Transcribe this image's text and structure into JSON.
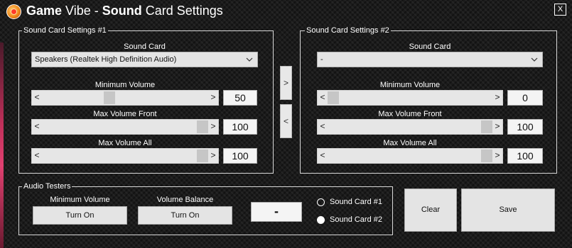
{
  "window": {
    "title_part1": "Game",
    "title_part2": " Vibe - ",
    "title_part3": "Sound",
    "title_part4": " Card Settings",
    "close_label": "X"
  },
  "group1": {
    "title": "Sound Card Settings #1",
    "sound_card_label": "Sound Card",
    "sound_card_value": "Speakers (Realtek High Definition Audio)",
    "min_volume_label": "Minimum Volume",
    "min_volume_value": "50",
    "min_volume_level": 0.4,
    "max_front_label": "Max Volume Front",
    "max_front_value": "100",
    "max_front_level": 1.0,
    "max_all_label": "Max Volume All",
    "max_all_value": "100",
    "max_all_level": 1.0
  },
  "group2": {
    "title": "Sound Card Settings #2",
    "sound_card_label": "Sound Card",
    "sound_card_value": "-",
    "min_volume_label": "Minimum Volume",
    "min_volume_value": "0",
    "min_volume_level": 0.0,
    "max_front_label": "Max Volume Front",
    "max_front_value": "100",
    "max_front_level": 1.0,
    "max_all_label": "Max Volume All",
    "max_all_value": "100",
    "max_all_level": 1.0
  },
  "transfer": {
    "right_label": ">",
    "left_label": "<"
  },
  "audio_testers": {
    "title": "Audio Testers",
    "min_volume_label": "Minimum Volume",
    "min_volume_button": "Turn On",
    "balance_label": "Volume Balance",
    "balance_button": "Turn On",
    "dash_button": "-",
    "radio1_label": "Sound Card #1",
    "radio1_checked": false,
    "radio2_label": "Sound Card #2",
    "radio2_checked": true
  },
  "actions": {
    "clear_label": "Clear",
    "save_label": "Save"
  },
  "icons": {
    "slider_left": "<",
    "slider_right": ">",
    "dropdown": "chevron-down-icon"
  },
  "colors": {
    "background": "#1b1b1b",
    "border": "#d8d8d8",
    "control": "#e4e4e4"
  }
}
